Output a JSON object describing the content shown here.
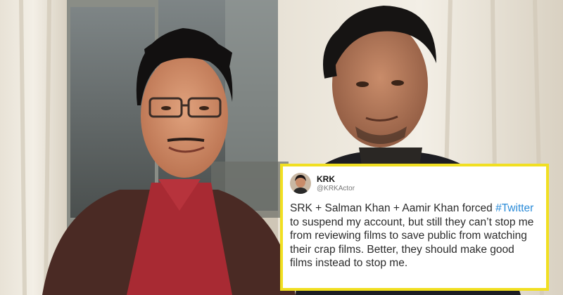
{
  "tweet": {
    "display_name": "KRK",
    "handle": "@KRKActor",
    "text_before": "SRK + Salman Khan + Aamir Khan forced ",
    "hashtag": "#Twitter",
    "text_after": " to suspend my account, but still they can’t stop me from reviewing films to save public from watching their crap films. Better, they should make good films instead to stop me."
  },
  "colors": {
    "card_border": "#f1df21",
    "hashtag": "#2a8bd8",
    "text": "#2b2b2b"
  }
}
